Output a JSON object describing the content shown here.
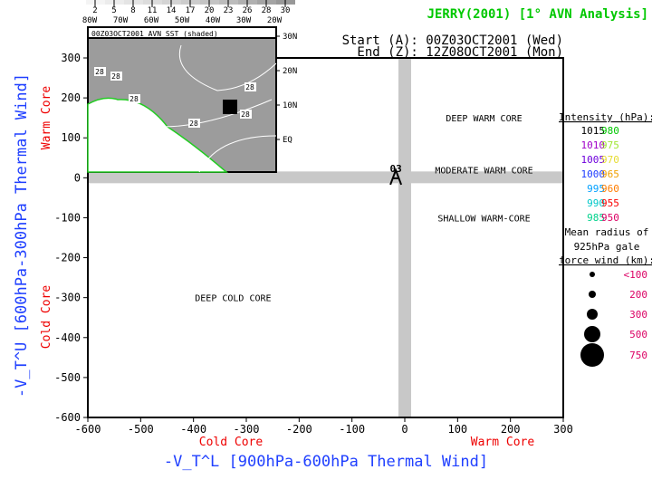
{
  "header": {
    "title": "JERRY(2001) [1° AVN Analysis]",
    "start_line": "Start (A): 00Z03OCT2001 (Wed)",
    "end_line": "End (Z): 12Z08OCT2001 (Mon)"
  },
  "chart_data": {
    "type": "scatter",
    "xlabel": "-V_T^L [900hPa-600hPa Thermal Wind]",
    "ylabel": "-V_T^U [600hPa-300hPa Thermal Wind]",
    "xlim": [
      -600,
      300
    ],
    "ylim": [
      -600,
      300
    ],
    "xticks": [
      -600,
      -500,
      -400,
      -300,
      -200,
      -100,
      0,
      100,
      200,
      300
    ],
    "yticks": [
      -600,
      -500,
      -400,
      -300,
      -200,
      -100,
      0,
      100,
      200,
      300
    ],
    "x_left_label": "Cold Core",
    "x_right_label": "Warm Core",
    "y_top_label": "Warm Core",
    "y_bottom_label": "Cold Core",
    "regions": [
      {
        "label": "DEEP WARM CORE",
        "x": 150,
        "y": 150
      },
      {
        "label": "MODERATE WARM CORE",
        "x": 150,
        "y": 20
      },
      {
        "label": "SHALLOW WARM-CORE",
        "x": 150,
        "y": -100
      },
      {
        "label": "DEEP COLD CORE",
        "x": -325,
        "y": -300
      }
    ],
    "points": [
      {
        "label": "A",
        "x": -17,
        "y": 10,
        "day": "03"
      }
    ],
    "grid": false
  },
  "inset": {
    "title": "00Z03OCT2001 AVN SST (shaded)",
    "sst_colorbar": [
      "2",
      "5",
      "8",
      "11",
      "14",
      "17",
      "20",
      "23",
      "26",
      "28",
      "30"
    ],
    "lon_labels": [
      "80W",
      "70W",
      "60W",
      "50W",
      "40W",
      "30W",
      "20W"
    ],
    "lat_labels": [
      "30N",
      "20N",
      "10N",
      "EQ"
    ],
    "contour_label": "28"
  },
  "legend": {
    "intensity_title": "Intensity (hPa):",
    "intensity": [
      {
        "value": "1015",
        "color": "#000000"
      },
      {
        "value": "980",
        "color": "#00c800"
      },
      {
        "value": "1010",
        "color": "#a000c8"
      },
      {
        "value": "975",
        "color": "#a0e632"
      },
      {
        "value": "1005",
        "color": "#6e00dc"
      },
      {
        "value": "970",
        "color": "#e6dc32"
      },
      {
        "value": "1000",
        "color": "#1e3cff"
      },
      {
        "value": "965",
        "color": "#f0a000"
      },
      {
        "value": "995",
        "color": "#00a0ff"
      },
      {
        "value": "960",
        "color": "#ff7d00"
      },
      {
        "value": "990",
        "color": "#00c8c8"
      },
      {
        "value": "955",
        "color": "#fa0000"
      },
      {
        "value": "985",
        "color": "#00d28c"
      },
      {
        "value": "950",
        "color": "#dc0064"
      }
    ],
    "radius_title_1": "Mean radius of",
    "radius_title_2": "925hPa gale",
    "radius_title_3": "force wind (km):",
    "radius": [
      "<100",
      "200",
      "300",
      "500",
      "750"
    ]
  }
}
